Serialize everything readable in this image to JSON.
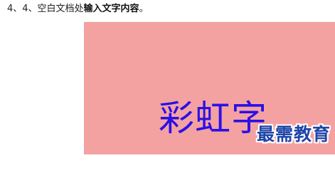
{
  "step": {
    "prefix": "4、4、空白文档处",
    "emphasis": "输入文字内容",
    "suffix": "。"
  },
  "canvas": {
    "background": "#f4a1a2",
    "text": "彩虹字",
    "text_color": "#2a10e6"
  },
  "watermark": {
    "text": "最需教育",
    "color": "#1f45a8"
  }
}
